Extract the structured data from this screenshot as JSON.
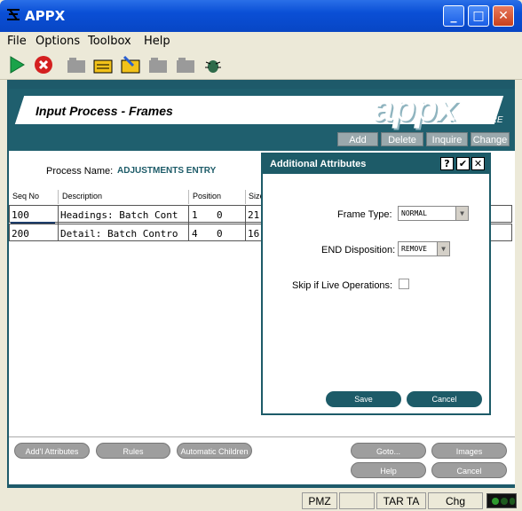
{
  "window": {
    "title": "APPX"
  },
  "menu": [
    "File",
    "Options",
    "Toolbox",
    "Help"
  ],
  "toolbar_icons": [
    "run-icon",
    "stop-icon",
    "folder-icon",
    "note-icon",
    "edit-icon",
    "folder-icon",
    "folder-icon",
    "bug-icon"
  ],
  "banner": {
    "title": "Input Process - Frames",
    "logo": "appx",
    "logo_sub": "SOFTWARE"
  },
  "actions": [
    "Add",
    "Delete",
    "Inquire",
    "Change"
  ],
  "process": {
    "label": "Process Name:",
    "value": "ADJUSTMENTS ENTRY"
  },
  "table": {
    "headers": [
      "Seq No",
      "Description",
      "Position",
      "Size"
    ],
    "rows": [
      {
        "seq": "100",
        "desc": "Headings: Batch Cont",
        "pos1": "1",
        "pos2": "0",
        "size": "21"
      },
      {
        "seq": "200",
        "desc": "Detail: Batch Contro",
        "pos1": "4",
        "pos2": "0",
        "size": "16"
      }
    ]
  },
  "dialog": {
    "title": "Additional Attributes",
    "help": "?",
    "ok": "✔",
    "close": "✕",
    "frame_type_label": "Frame Type:",
    "frame_type_value": "NORMAL",
    "end_disp_label": "END Disposition:",
    "end_disp_value": "REMOVE",
    "skip_label": "Skip if Live Operations:",
    "save": "Save",
    "cancel": "Cancel"
  },
  "bottom_buttons": {
    "attrs": "Add'l Attributes",
    "rules": "Rules",
    "auto": "Automatic Children",
    "goto": "Goto...",
    "images": "Images",
    "help": "Help",
    "cancel": "Cancel"
  },
  "status": {
    "pmz": "PMZ",
    "tar": "TAR TA",
    "chg": "Chg"
  }
}
